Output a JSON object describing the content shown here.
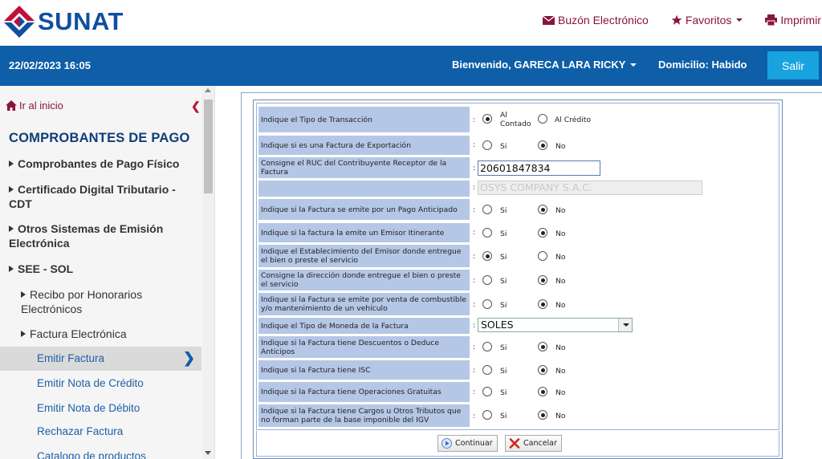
{
  "header": {
    "logo_text": "SUNAT",
    "links": [
      {
        "label": "Buzón Electrónico",
        "icon": "envelope-icon"
      },
      {
        "label": "Favoritos",
        "icon": "star-icon"
      },
      {
        "label": "Imprimir",
        "icon": "printer-icon"
      }
    ]
  },
  "bluebar": {
    "datetime": "22/02/2023 16:05",
    "welcome": "Bienvenido, GARECA LARA RICKY",
    "domicilio": "Domicilio: Habido",
    "logout": "Salir"
  },
  "sidebar": {
    "home": "Ir al inicio",
    "section_title": "COMPROBANTES DE PAGO",
    "items": [
      "Comprobantes de Pago Físico",
      "Certificado Digital Tributario - CDT",
      "Otros Sistemas de Emisión Electrónica",
      "SEE - SOL"
    ],
    "sub_items": [
      "Recibo por Honorarios Electrónicos",
      "Factura Electrónica"
    ],
    "leaves": [
      "Emitir Factura",
      "Emitir Nota de Crédito",
      "Emitir Nota de Débito",
      "Rechazar Factura",
      "Catalogo de productos"
    ],
    "active_leaf": "Emitir Factura"
  },
  "form": {
    "rows": [
      {
        "label": "Indique el Tipo de Transacción",
        "opt1": "Al Contado",
        "opt2": "Al Crédito",
        "selected": 1
      },
      {
        "label": "Indique si es una Factura de Exportación",
        "opt1": "Si",
        "opt2": "No",
        "selected": 2
      },
      {
        "label": "Consigne el RUC del Contribuyente Receptor de la Factura",
        "value": "20601847834"
      },
      {
        "label": "",
        "value": "OSYS COMPANY S.A.C."
      },
      {
        "label": "Indique si la Factura se emite por un Pago Anticipado",
        "opt1": "Si",
        "opt2": "No",
        "selected": 2
      },
      {
        "label": "Indique si la factura la emite un Emisor Itinerante",
        "opt1": "Si",
        "opt2": "No",
        "selected": 2
      },
      {
        "label": "Indique el Establecimiento del Emisor donde entregue el bien o preste el servicio",
        "opt1": "Si",
        "opt2": "No",
        "selected": 1
      },
      {
        "label": "Consigne la dirección donde entregue el bien o preste el servicio",
        "opt1": "Si",
        "opt2": "No",
        "selected": 2
      },
      {
        "label": "Indique si la Factura se emite por venta de combustible y/o mantenimiento de un vehículo",
        "opt1": "Si",
        "opt2": "No",
        "selected": 2
      },
      {
        "label": "Indique el Tipo de Moneda de la Factura",
        "value": "SOLES"
      },
      {
        "label": "Indique si la Factura tiene Descuentos o Deduce Anticipos",
        "opt1": "Si",
        "opt2": "No",
        "selected": 2
      },
      {
        "label": "Indique si la Factura tiene ISC",
        "opt1": "Si",
        "opt2": "No",
        "selected": 2
      },
      {
        "label": "Indique si la Factura tiene Operaciones Gratuitas",
        "opt1": "Si",
        "opt2": "No",
        "selected": 2
      },
      {
        "label": "Indique si la Factura tiene Cargos u Otros Tributos que no forman parte de la base imponible del IGV",
        "opt1": "Si",
        "opt2": "No",
        "selected": 2
      }
    ],
    "colon": ":",
    "continue_label": "Continuar",
    "cancel_label": "Cancelar"
  },
  "colors": {
    "brand_blue": "#0e5ea8",
    "brand_red": "#c0103a",
    "label_bg": "#b5c7e6",
    "logout_bg": "#18a3e0"
  }
}
